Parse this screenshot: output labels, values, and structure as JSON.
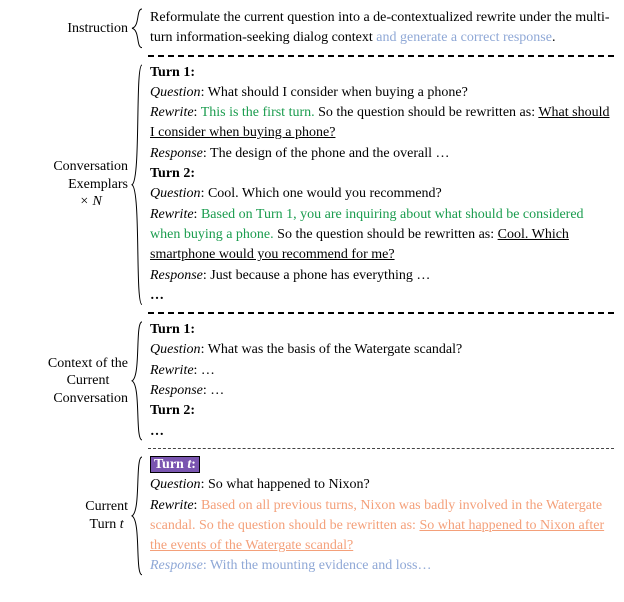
{
  "instruction": {
    "label": "Instruction",
    "text_main": "Reformulate the current question into a de-contextualized rewrite under the multi-turn information-seeking dialog context ",
    "text_blue": "and generate a correct response",
    "period": "."
  },
  "exemplars": {
    "label_line1": "Conversation",
    "label_line2": "Exemplars",
    "label_line3": "× N",
    "turn1_header": "Turn 1:",
    "turn1_q_label": "Question",
    "turn1_q_text": ": What should I consider when buying a phone?",
    "turn1_r_label": "Rewrite",
    "turn1_r_pre": ": ",
    "turn1_r_green": "This is the first turn.",
    "turn1_r_mid": " So the question should be rewritten as: ",
    "turn1_r_underline": "What should I consider when buying a phone?",
    "turn1_resp_label": "Response",
    "turn1_resp_text": ": The design of the phone and the overall …",
    "turn2_header": "Turn 2:",
    "turn2_q_label": "Question",
    "turn2_q_text": ": Cool. Which one would you recommend?",
    "turn2_r_label": "Rewrite",
    "turn2_r_pre": ": ",
    "turn2_r_green": "Based on Turn 1, you are inquiring about what should be considered when buying a phone.",
    "turn2_r_mid": " So the question should be rewritten as: ",
    "turn2_r_underline": "Cool. Which smartphone would you recommend for me?",
    "turn2_resp_label": "Response",
    "turn2_resp_text": ": Just because a phone has everything …",
    "ellipsis": "…"
  },
  "context": {
    "label_line1": "Context of the",
    "label_line2": "Current",
    "label_line3": "Conversation",
    "turn1_header": "Turn 1:",
    "turn1_q_label": "Question",
    "turn1_q_text": ": What was the basis of the Watergate scandal?",
    "turn1_r_label": "Rewrite",
    "turn1_r_text": ": …",
    "turn1_resp_label": "Response",
    "turn1_resp_text": ": …",
    "turn2_header": "Turn 2:",
    "ellipsis": "…"
  },
  "current": {
    "label_line1": "Current",
    "label_line2": "Turn t",
    "turn_header_pre": "Turn ",
    "turn_header_it": "t",
    "turn_header_post": ":",
    "q_label": "Question",
    "q_text": ": So what happened to Nixon?",
    "r_label": "Rewrite",
    "r_pre": ": ",
    "r_orange1": "Based on all previous turns, Nixon was badly involved in the Watergate scandal. So the question should be rewritten as: ",
    "r_orange_underline": "So what happened to Nixon after the events of the Watergate scandal?",
    "resp_label": "Response",
    "resp_pre": ": ",
    "resp_blue": "With the mounting evidence and loss…"
  }
}
